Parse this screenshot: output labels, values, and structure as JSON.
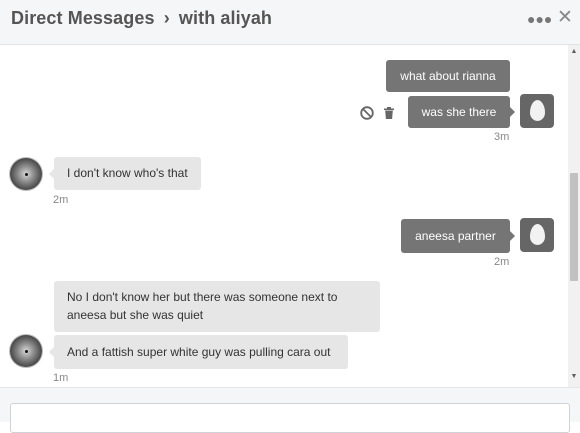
{
  "header": {
    "title": "Direct Messages",
    "separator": "›",
    "subtitle": "with aliyah",
    "more_icon": "more-horizontal-icon",
    "close_icon": "close-icon"
  },
  "messages": [
    {
      "direction": "outgoing",
      "text": "what about rianna"
    },
    {
      "direction": "outgoing",
      "text": "was she there",
      "time": "3m",
      "actions": [
        "block-icon",
        "trash-icon"
      ]
    },
    {
      "direction": "incoming",
      "text": "I don't know who's that",
      "time": "2m"
    },
    {
      "direction": "outgoing",
      "text": "aneesa partner",
      "time": "2m"
    },
    {
      "direction": "incoming",
      "text": "No I don't know her but there was someone next to"
    },
    {
      "direction": "incoming",
      "text": "aneesa but she was quiet"
    },
    {
      "direction": "incoming",
      "text": "And a fattish super white guy was pulling cara out",
      "time": "1m"
    }
  ],
  "compose": {
    "placeholder": ""
  },
  "colors": {
    "outgoing_bubble": "#757575",
    "incoming_bubble": "#e6e6e6",
    "header_bg": "#f5f6f7"
  }
}
